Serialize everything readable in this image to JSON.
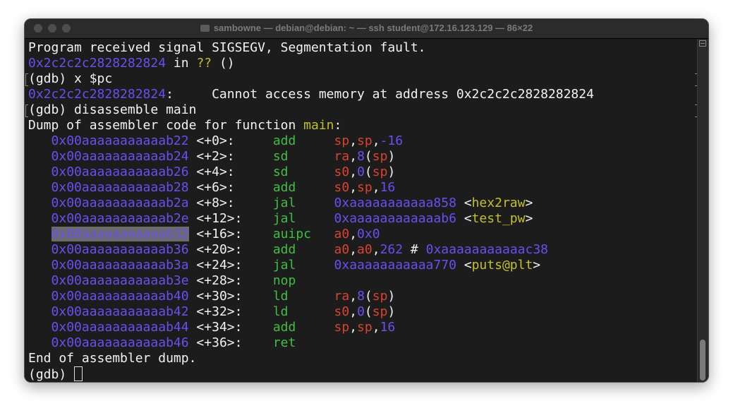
{
  "window": {
    "title": "sambowne — debian@debian: ~ — ssh student@172.16.123.129 — 86×22"
  },
  "colors": {
    "address": "#6a4ff0",
    "mnemonic": "#3fbf3f",
    "register": "#d8432f",
    "symbol": "#c2c02c"
  },
  "lines": [
    {
      "segs": [
        [
          "w",
          "Program received signal SIGSEGV, Segmentation fault."
        ]
      ]
    },
    {
      "segs": [
        [
          "addr",
          "0x2c2c2c2828282824"
        ],
        [
          "w",
          " in "
        ],
        [
          "sym",
          "??"
        ],
        [
          "w",
          " ()"
        ]
      ]
    },
    {
      "mark": true,
      "segs": [
        [
          "w",
          "(gdb) x $pc"
        ]
      ]
    },
    {
      "segs": [
        [
          "addr",
          "0x2c2c2c2828282824"
        ],
        [
          "w",
          ":     Cannot access memory at address 0x2c2c2c2828282824"
        ]
      ]
    },
    {
      "mark": true,
      "segs": [
        [
          "w",
          "(gdb) disassemble main"
        ]
      ]
    },
    {
      "segs": [
        [
          "w",
          "Dump of assembler code for function "
        ],
        [
          "sym",
          "main"
        ],
        [
          "w",
          ":"
        ]
      ]
    },
    {
      "segs": [
        [
          "w",
          "   "
        ],
        [
          "addr",
          "0x00aaaaaaaaaaab22"
        ],
        [
          "w",
          " <+0>:     "
        ],
        [
          "mn",
          "add"
        ],
        [
          "w",
          "     "
        ],
        [
          "reg",
          "sp"
        ],
        [
          "w",
          ","
        ],
        [
          "reg",
          "sp"
        ],
        [
          "w",
          ","
        ],
        [
          "num",
          "-16"
        ]
      ]
    },
    {
      "segs": [
        [
          "w",
          "   "
        ],
        [
          "addr",
          "0x00aaaaaaaaaaab24"
        ],
        [
          "w",
          " <+2>:     "
        ],
        [
          "mn",
          "sd"
        ],
        [
          "w",
          "      "
        ],
        [
          "reg",
          "ra"
        ],
        [
          "w",
          ","
        ],
        [
          "num",
          "8"
        ],
        [
          "w",
          "("
        ],
        [
          "reg",
          "sp"
        ],
        [
          "w",
          ")"
        ]
      ]
    },
    {
      "segs": [
        [
          "w",
          "   "
        ],
        [
          "addr",
          "0x00aaaaaaaaaaab26"
        ],
        [
          "w",
          " <+4>:     "
        ],
        [
          "mn",
          "sd"
        ],
        [
          "w",
          "      "
        ],
        [
          "reg",
          "s0"
        ],
        [
          "w",
          ","
        ],
        [
          "num",
          "0"
        ],
        [
          "w",
          "("
        ],
        [
          "reg",
          "sp"
        ],
        [
          "w",
          ")"
        ]
      ]
    },
    {
      "segs": [
        [
          "w",
          "   "
        ],
        [
          "addr",
          "0x00aaaaaaaaaaab28"
        ],
        [
          "w",
          " <+6>:     "
        ],
        [
          "mn",
          "add"
        ],
        [
          "w",
          "     "
        ],
        [
          "reg",
          "s0"
        ],
        [
          "w",
          ","
        ],
        [
          "reg",
          "sp"
        ],
        [
          "w",
          ","
        ],
        [
          "num",
          "16"
        ]
      ]
    },
    {
      "segs": [
        [
          "w",
          "   "
        ],
        [
          "addr",
          "0x00aaaaaaaaaaab2a"
        ],
        [
          "w",
          " <+8>:     "
        ],
        [
          "mn",
          "jal"
        ],
        [
          "w",
          "     "
        ],
        [
          "num",
          "0xaaaaaaaaaaa858"
        ],
        [
          "w",
          " <"
        ],
        [
          "sym",
          "hex2raw"
        ],
        [
          "w",
          ">"
        ]
      ]
    },
    {
      "segs": [
        [
          "w",
          "   "
        ],
        [
          "addr",
          "0x00aaaaaaaaaaab2e"
        ],
        [
          "w",
          " <+12>:    "
        ],
        [
          "mn",
          "jal"
        ],
        [
          "w",
          "     "
        ],
        [
          "num",
          "0xaaaaaaaaaaaab6"
        ],
        [
          "w",
          " <"
        ],
        [
          "sym",
          "test_pw"
        ],
        [
          "w",
          ">"
        ]
      ]
    },
    {
      "segs": [
        [
          "w",
          "   "
        ],
        [
          "addr sel",
          "0x00aaaaaaaaaaab32"
        ],
        [
          "w",
          " <+16>:    "
        ],
        [
          "mn",
          "auipc"
        ],
        [
          "w",
          "   "
        ],
        [
          "reg",
          "a0"
        ],
        [
          "w",
          ","
        ],
        [
          "num",
          "0x0"
        ]
      ]
    },
    {
      "segs": [
        [
          "w",
          "   "
        ],
        [
          "addr",
          "0x00aaaaaaaaaaab36"
        ],
        [
          "w",
          " <+20>:    "
        ],
        [
          "mn",
          "add"
        ],
        [
          "w",
          "     "
        ],
        [
          "reg",
          "a0"
        ],
        [
          "w",
          ","
        ],
        [
          "reg",
          "a0"
        ],
        [
          "w",
          ","
        ],
        [
          "num",
          "262"
        ],
        [
          "w",
          " # "
        ],
        [
          "num",
          "0xaaaaaaaaaaac38"
        ]
      ]
    },
    {
      "segs": [
        [
          "w",
          "   "
        ],
        [
          "addr",
          "0x00aaaaaaaaaaab3a"
        ],
        [
          "w",
          " <+24>:    "
        ],
        [
          "mn",
          "jal"
        ],
        [
          "w",
          "     "
        ],
        [
          "num",
          "0xaaaaaaaaaaa770"
        ],
        [
          "w",
          " <"
        ],
        [
          "sym",
          "puts@plt"
        ],
        [
          "w",
          ">"
        ]
      ]
    },
    {
      "segs": [
        [
          "w",
          "   "
        ],
        [
          "addr",
          "0x00aaaaaaaaaaab3e"
        ],
        [
          "w",
          " <+28>:    "
        ],
        [
          "mn",
          "nop"
        ]
      ]
    },
    {
      "segs": [
        [
          "w",
          "   "
        ],
        [
          "addr",
          "0x00aaaaaaaaaaab40"
        ],
        [
          "w",
          " <+30>:    "
        ],
        [
          "mn",
          "ld"
        ],
        [
          "w",
          "      "
        ],
        [
          "reg",
          "ra"
        ],
        [
          "w",
          ","
        ],
        [
          "num",
          "8"
        ],
        [
          "w",
          "("
        ],
        [
          "reg",
          "sp"
        ],
        [
          "w",
          ")"
        ]
      ]
    },
    {
      "segs": [
        [
          "w",
          "   "
        ],
        [
          "addr",
          "0x00aaaaaaaaaaab42"
        ],
        [
          "w",
          " <+32>:    "
        ],
        [
          "mn",
          "ld"
        ],
        [
          "w",
          "      "
        ],
        [
          "reg",
          "s0"
        ],
        [
          "w",
          ","
        ],
        [
          "num",
          "0"
        ],
        [
          "w",
          "("
        ],
        [
          "reg",
          "sp"
        ],
        [
          "w",
          ")"
        ]
      ]
    },
    {
      "segs": [
        [
          "w",
          "   "
        ],
        [
          "addr",
          "0x00aaaaaaaaaaab44"
        ],
        [
          "w",
          " <+34>:    "
        ],
        [
          "mn",
          "add"
        ],
        [
          "w",
          "     "
        ],
        [
          "reg",
          "sp"
        ],
        [
          "w",
          ","
        ],
        [
          "reg",
          "sp"
        ],
        [
          "w",
          ","
        ],
        [
          "num",
          "16"
        ]
      ]
    },
    {
      "segs": [
        [
          "w",
          "   "
        ],
        [
          "addr",
          "0x00aaaaaaaaaaab46"
        ],
        [
          "w",
          " <+36>:    "
        ],
        [
          "mn",
          "ret"
        ]
      ]
    },
    {
      "segs": [
        [
          "w",
          "End of assembler dump."
        ]
      ]
    },
    {
      "cursor": true,
      "segs": [
        [
          "w",
          "(gdb) "
        ]
      ]
    }
  ]
}
